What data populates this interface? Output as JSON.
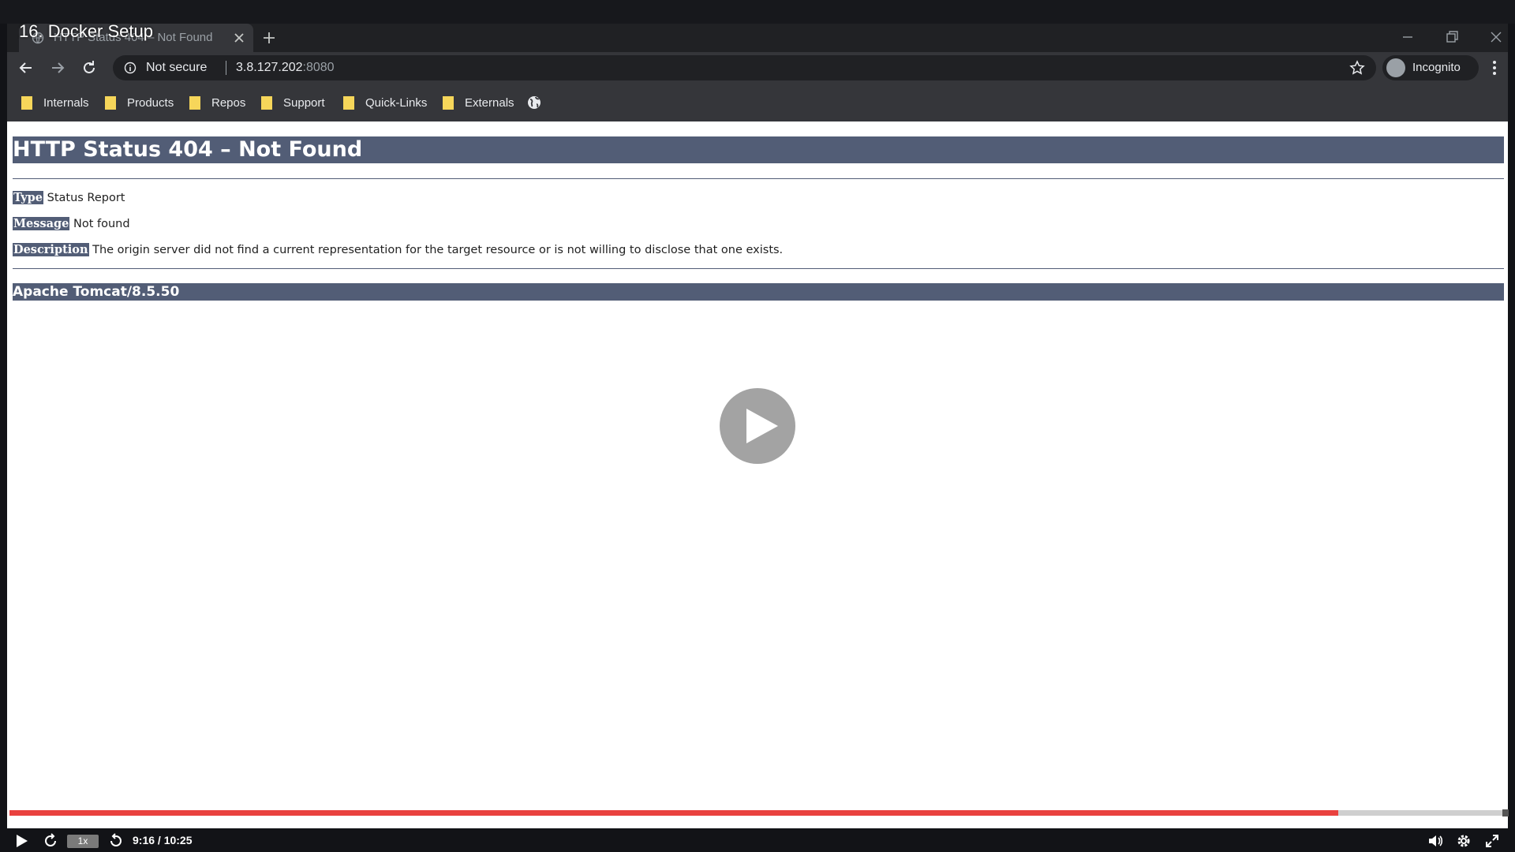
{
  "video": {
    "title": "16. Docker Setup",
    "time_display": "9:16 / 10:25",
    "speed": "1x",
    "progress_fraction": 0.888
  },
  "browser": {
    "tab_title": "HTTP Status 404 – Not Found",
    "address": {
      "security_label": "Not secure",
      "host": "3.8.127.202",
      "port": ":8080"
    },
    "profile_label": "Incognito",
    "bookmarks": [
      "Internals",
      "Products",
      "Repos",
      "Support",
      "Quick-Links",
      "Externals"
    ]
  },
  "page": {
    "heading": "HTTP Status 404 – Not Found",
    "type_label": "Type",
    "type_value": "Status Report",
    "message_label": "Message",
    "message_value": "Not found",
    "description_label": "Description",
    "description_value": "The origin server did not find a current representation for the target resource or is not willing to disclose that one exists.",
    "server_footer": "Apache Tomcat/8.5.50"
  },
  "colors": {
    "tomcat_header": "#525d76",
    "progress": "#e9413e",
    "chrome_dark": "#202124"
  }
}
